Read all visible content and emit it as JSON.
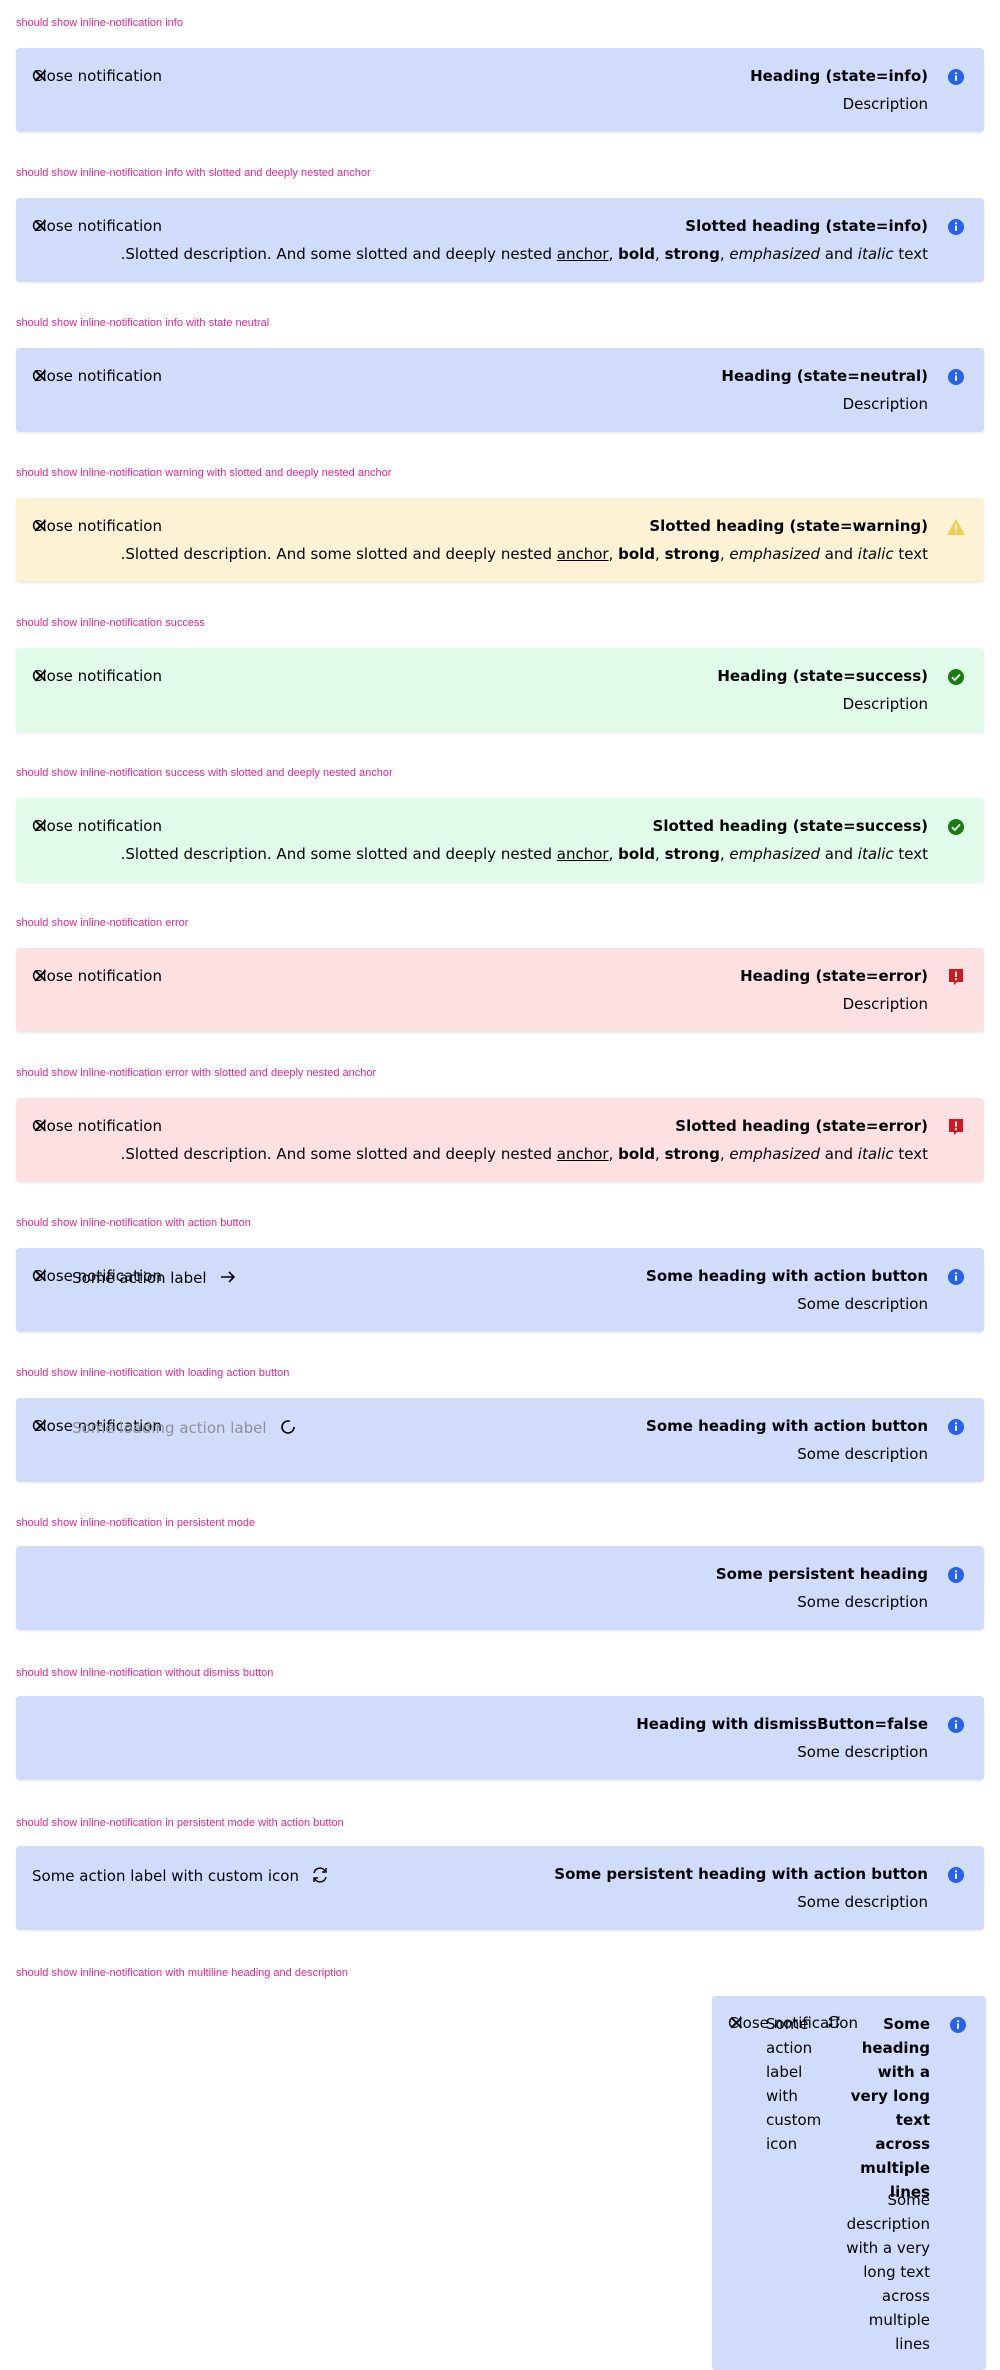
{
  "sections": [
    {
      "label": "should show inline-notification info",
      "state": "info",
      "heading": "Heading (state=info)",
      "description": "Description",
      "close": "Close notification"
    },
    {
      "label": "should show inline-notification info with slotted and deeply nested anchor",
      "state": "info",
      "heading": "Slotted heading (state=info)",
      "close": "Close notification"
    },
    {
      "label": "should show inline-notification info with state neutral",
      "state": "neutral",
      "heading": "Heading (state=neutral)",
      "description": "Description",
      "close": "Close notification"
    },
    {
      "label": "should show inline-notification warning with slotted and deeply nested anchor",
      "state": "warning",
      "heading": "Slotted heading (state=warning)",
      "close": "Close notification"
    },
    {
      "label": "should show inline-notification success",
      "state": "success",
      "heading": "Heading (state=success)",
      "description": "Description",
      "close": "Close notification"
    },
    {
      "label": "should show inline-notification success with slotted and deeply nested anchor",
      "state": "success",
      "heading": "Slotted heading (state=success)",
      "close": "Close notification"
    },
    {
      "label": "should show inline-notification error",
      "state": "error",
      "heading": "Heading (state=error)",
      "description": "Description",
      "close": "Close notification"
    },
    {
      "label": "should show inline-notification error with slotted and deeply nested anchor",
      "state": "error",
      "heading": "Slotted heading (state=error)",
      "close": "Close notification"
    },
    {
      "label": "should show inline-notification with action button",
      "state": "info",
      "heading": "Some heading with action button",
      "description": "Some description",
      "close": "Close notification",
      "action": "Some action label"
    },
    {
      "label": "should show inline-notification with loading action button",
      "state": "info",
      "heading": "Some heading with action button",
      "description": "Some description",
      "close": "Close notification",
      "action": "Some loading action label"
    },
    {
      "label": "should show inline-notification in persistent mode",
      "state": "info",
      "heading": "Some persistent heading",
      "description": "Some description"
    },
    {
      "label": "should show inline-notification without dismiss button",
      "state": "info",
      "heading": "Heading with dismissButton=false",
      "description": "Some description"
    },
    {
      "label": "should show inline-notification in persistent mode with action button",
      "state": "info",
      "heading": "Some persistent heading with action button",
      "description": "Some description",
      "action": "Some action label with custom icon"
    },
    {
      "label": "should show inline-notification with multiline heading and description",
      "state": "info",
      "heading": "Some heading with a very long text across multiple lines",
      "description": "Some description with a very long text across multiple lines",
      "close": "Close notification",
      "action": "Some action label with custom icon"
    }
  ],
  "slotted": {
    "prefix": ".Slotted description. And some slotted and deeply nested ",
    "anchor": "anchor",
    "comma1": ", ",
    "bold": "bold",
    "comma2": ", ",
    "strong": "strong",
    "comma3": ", ",
    "emphasized": "emphasized",
    "and": " and ",
    "italic": "italic",
    "suffix": " text"
  },
  "icons": {
    "info": "information-icon",
    "neutral": "information-icon",
    "warning": "warning-icon",
    "success": "success-icon",
    "error": "error-icon",
    "close": "close-icon",
    "arrow": "arrow-right-icon",
    "spinner": "spinner-icon",
    "reset": "reset-icon"
  },
  "colors": {
    "info_bg": "#d1dcfa",
    "warning_bg": "#fdf2d4",
    "success_bg": "#e0fbe9",
    "error_bg": "#fde0e1",
    "info_icon": "#2762ec",
    "warning_icon": "#f7cb47",
    "success_icon": "#197e10",
    "error_icon": "#cc1922",
    "label_pink": "#e3268f"
  }
}
